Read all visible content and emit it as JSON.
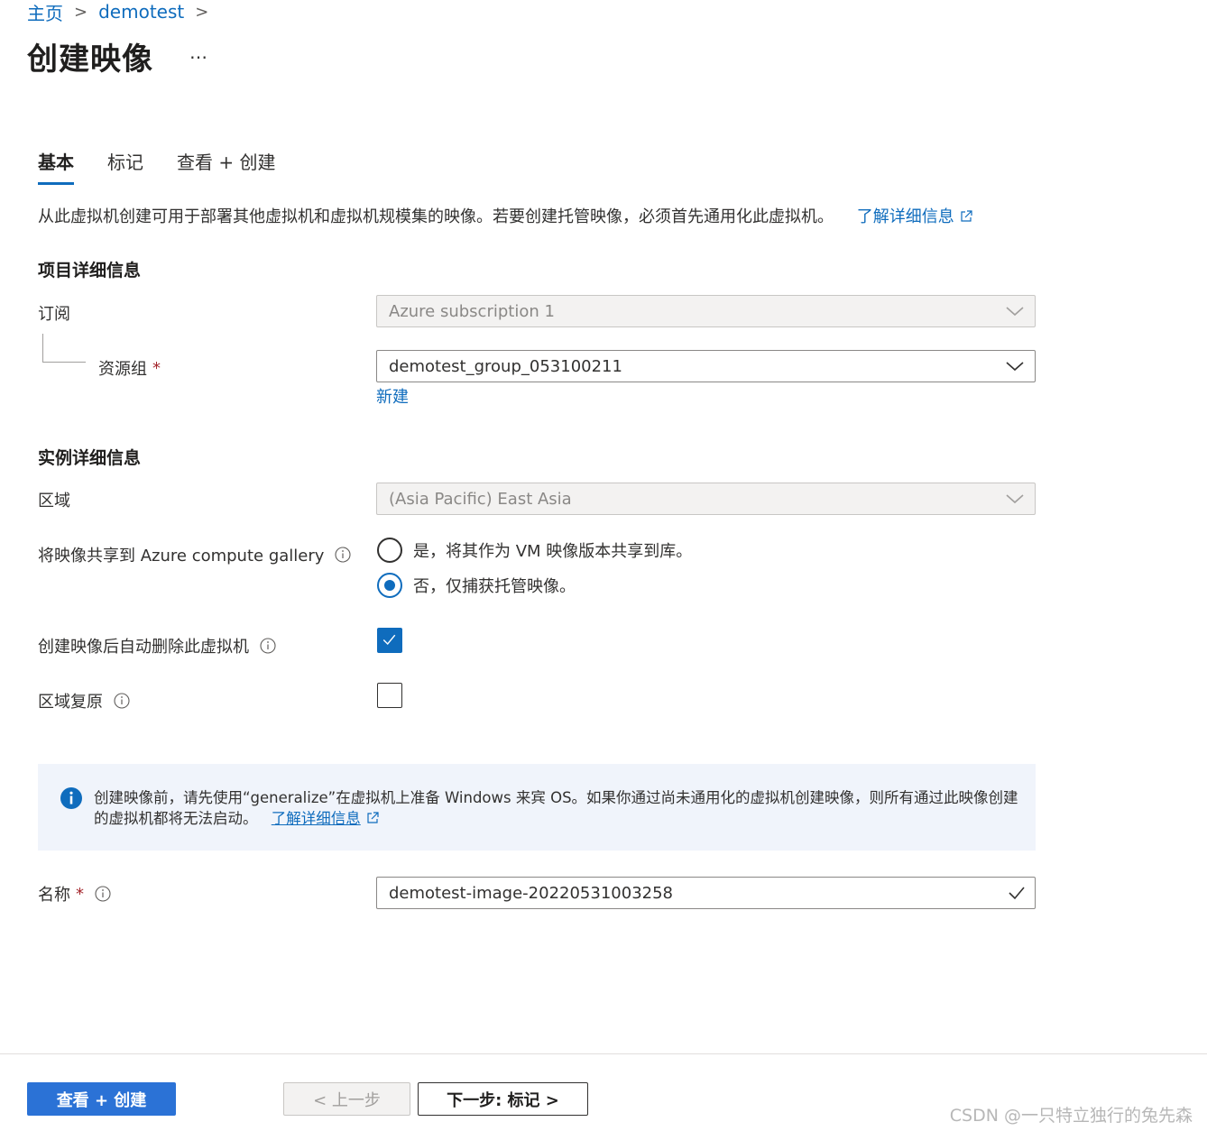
{
  "breadcrumb": [
    {
      "label": "主页"
    },
    {
      "label": "demotest"
    }
  ],
  "page": {
    "title": "创建映像",
    "more": "…"
  },
  "tabs": [
    {
      "label": "基本",
      "active": true
    },
    {
      "label": "标记",
      "active": false
    },
    {
      "label": "查看 + 创建",
      "active": false
    }
  ],
  "intro": {
    "text": "从此虚拟机创建可用于部署其他虚拟机和虚拟机规模集的映像。若要创建托管映像，必须首先通用化此虚拟机。",
    "link": "了解详细信息"
  },
  "project": {
    "heading": "项目详细信息",
    "subscription_label": "订阅",
    "subscription_value": "Azure subscription 1",
    "rg_label": "资源组",
    "rg_required": "*",
    "rg_value": "demotest_group_053100211",
    "rg_new_link": "新建"
  },
  "instance": {
    "heading": "实例详细信息",
    "region_label": "区域",
    "region_value": "(Asia Pacific) East Asia",
    "share_label": "将映像共享到 Azure compute gallery",
    "share_options": [
      {
        "label": "是，将其作为 VM 映像版本共享到库。",
        "selected": false
      },
      {
        "label": "否，仅捕获托管映像。",
        "selected": true
      }
    ],
    "autodelete_label": "创建映像后自动删除此虚拟机",
    "autodelete_checked": true,
    "zone_label": "区域复原",
    "zone_checked": false
  },
  "infobar": {
    "text": "创建映像前，请先使用“generalize”在虚拟机上准备 Windows 来宾 OS。如果你通过尚未通用化的虚拟机创建映像，则所有通过此映像创建的虚拟机都将无法启动。",
    "link": "了解详细信息"
  },
  "name_field": {
    "label": "名称",
    "required": "*",
    "value": "demotest-image-20220531003258"
  },
  "footer": {
    "review_create": "查看 + 创建",
    "prev": "< 上一步",
    "next": "下一步: 标记 >"
  },
  "watermark": "CSDN @一只特立独行的兔先森",
  "colors": {
    "accent": "#0f6cbd",
    "primary_button": "#2b72d6",
    "infobar_bg": "#f0f4fb",
    "required": "#a4262c"
  }
}
